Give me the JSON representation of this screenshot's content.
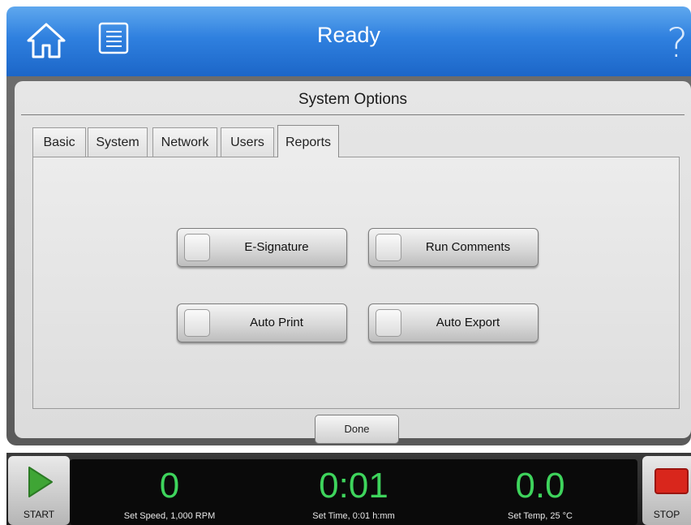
{
  "header": {
    "title": "Ready",
    "home_icon": "home-icon",
    "menu_icon": "list-icon",
    "help_icon": "help-icon",
    "help_glyph": "?"
  },
  "dialog": {
    "title": "System Options",
    "tabs": [
      {
        "label": "Basic",
        "active": false
      },
      {
        "label": "System",
        "active": false
      },
      {
        "label": "Network",
        "active": false
      },
      {
        "label": "Users",
        "active": false
      },
      {
        "label": "Reports",
        "active": true
      }
    ],
    "options": [
      {
        "label": "E-Signature",
        "checked": false
      },
      {
        "label": "Run Comments",
        "checked": false
      },
      {
        "label": "Auto Print",
        "checked": false
      },
      {
        "label": "Auto Export",
        "checked": false
      }
    ],
    "done_label": "Done"
  },
  "status": {
    "start_label": "START",
    "stop_label": "STOP",
    "speed": {
      "value": "0",
      "setpoint": "Set Speed, 1,000 RPM"
    },
    "time": {
      "value": "0:01",
      "setpoint": "Set Time, 0:01 h:mm"
    },
    "temp": {
      "value": "0.0",
      "setpoint": "Set Temp, 25 °C"
    }
  },
  "colors": {
    "header_blue": "#2f80df",
    "readout_green": "#3ed45c",
    "start_green": "#3fa535",
    "stop_red": "#d9261c"
  }
}
